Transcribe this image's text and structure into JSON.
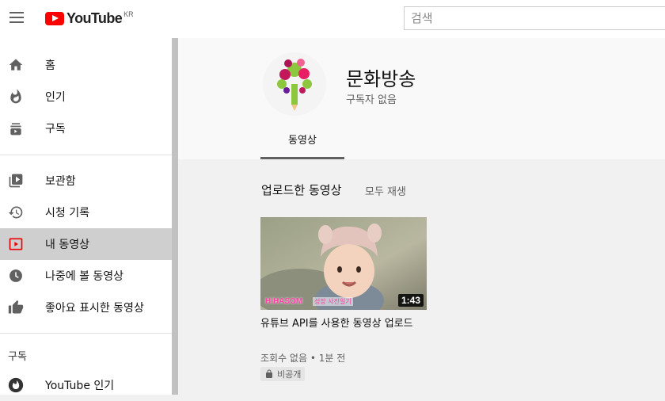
{
  "header": {
    "logo_text": "YouTube",
    "logo_region": "KR",
    "search_placeholder": "검색"
  },
  "sidebar": {
    "items": [
      {
        "label": "홈",
        "icon": "home-icon"
      },
      {
        "label": "인기",
        "icon": "fire-icon"
      },
      {
        "label": "구독",
        "icon": "subscriptions-icon"
      },
      {
        "label": "보관함",
        "icon": "library-icon"
      },
      {
        "label": "시청 기록",
        "icon": "history-icon"
      },
      {
        "label": "내 동영상",
        "icon": "my-videos-icon",
        "active": true
      },
      {
        "label": "나중에 볼 동영상",
        "icon": "clock-icon"
      },
      {
        "label": "좋아요 표시한 동영상",
        "icon": "thumb-up-icon"
      }
    ],
    "subscriptions_title": "구독",
    "subscriptions": [
      {
        "label": "YouTube 인기",
        "icon": "youtube-popular-icon"
      }
    ]
  },
  "channel": {
    "name": "문화방송",
    "subscribers": "구독자 없음",
    "tab": "동영상"
  },
  "uploads": {
    "title": "업로드한 동영상",
    "play_all": "모두 재생",
    "videos": [
      {
        "title": "유튜브 API를 사용한 동영상 업로드",
        "duration": "1:43",
        "meta": "조회수 없음 • 1분 전",
        "visibility": "비공개",
        "watermark": "HiHASOM",
        "watermark_sub": "성장 사진일기"
      }
    ]
  },
  "colors": {
    "brand": "#ff0000",
    "active_bg": "#cfcfcf"
  }
}
